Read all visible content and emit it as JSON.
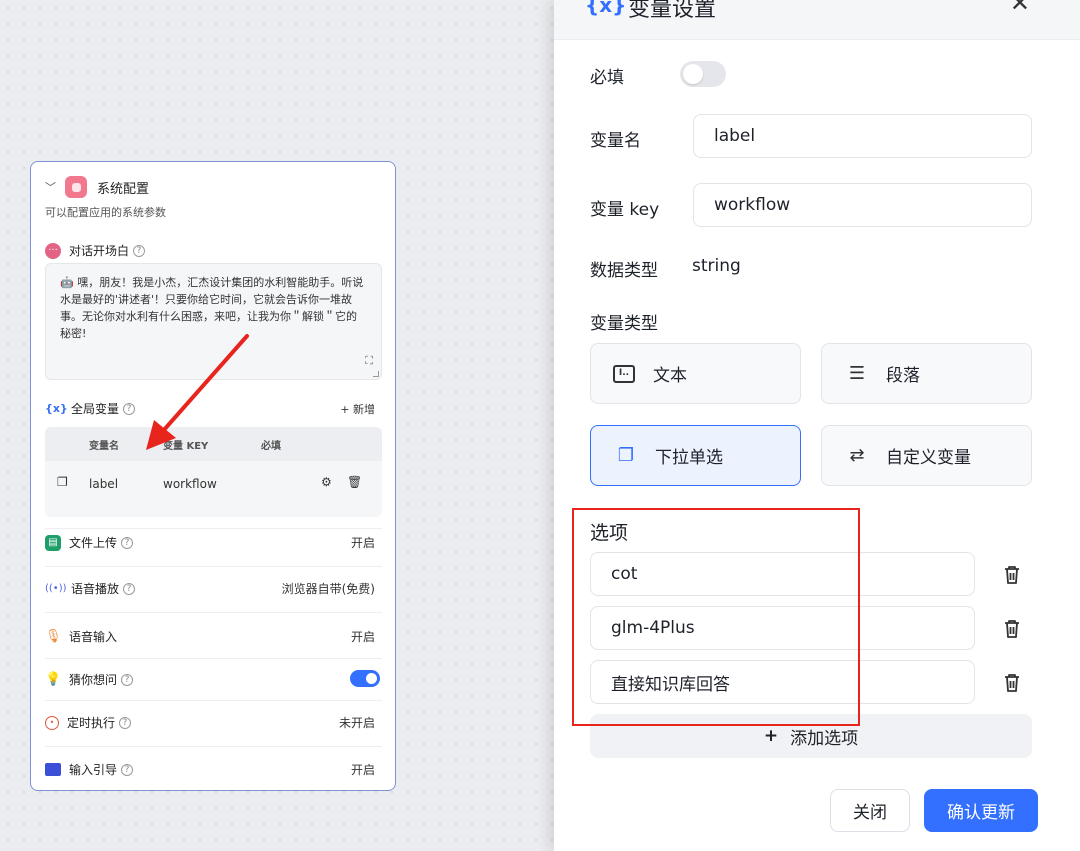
{
  "config_panel": {
    "title": "系统配置",
    "description": "可以配置应用的系统参数",
    "welcome": {
      "label": "对话开场白",
      "text": "🤖 嘿，朋友！我是小杰，汇杰设计集团的水利智能助手。听说水是最好的'讲述者'！只要你给它时间，它就会告诉你一堆故事。无论你对水利有什么困惑，来吧，让我为你＂解锁＂它的秘密!"
    },
    "global_vars": {
      "label": "全局变量",
      "add_label": "+ 新增",
      "headers": [
        "变量名",
        "变量 KEY",
        "必填"
      ],
      "rows": [
        {
          "name": "label",
          "key": "workflow"
        }
      ]
    },
    "settings": [
      {
        "label": "文件上传",
        "value": "开启"
      },
      {
        "label": "语音播放",
        "value": "浏览器自带(免费)"
      },
      {
        "label": "语音输入",
        "value": "开启"
      },
      {
        "label": "猜你想问",
        "value": ""
      },
      {
        "label": "定时执行",
        "value": "未开启"
      },
      {
        "label": "输入引导",
        "value": "开启"
      }
    ]
  },
  "drawer": {
    "icon_text": "{x}",
    "title": "变量设置",
    "required_label": "必填",
    "name_label": "变量名",
    "name_value": "label",
    "key_label": "变量 key",
    "key_value": "workflow",
    "datatype_label": "数据类型",
    "datatype_value": "string",
    "vartype_label": "变量类型",
    "var_types": [
      {
        "label": "文本"
      },
      {
        "label": "段落"
      },
      {
        "label": "下拉单选"
      },
      {
        "label": "自定义变量"
      }
    ],
    "options_label": "选项",
    "options": [
      "cot",
      "glm-4Plus",
      "直接知识库回答"
    ],
    "add_option_label": "添加选项",
    "close_label": "关闭",
    "confirm_label": "确认更新"
  },
  "colors": {
    "accent": "#3370ff",
    "annotation_red": "#e8251d"
  }
}
